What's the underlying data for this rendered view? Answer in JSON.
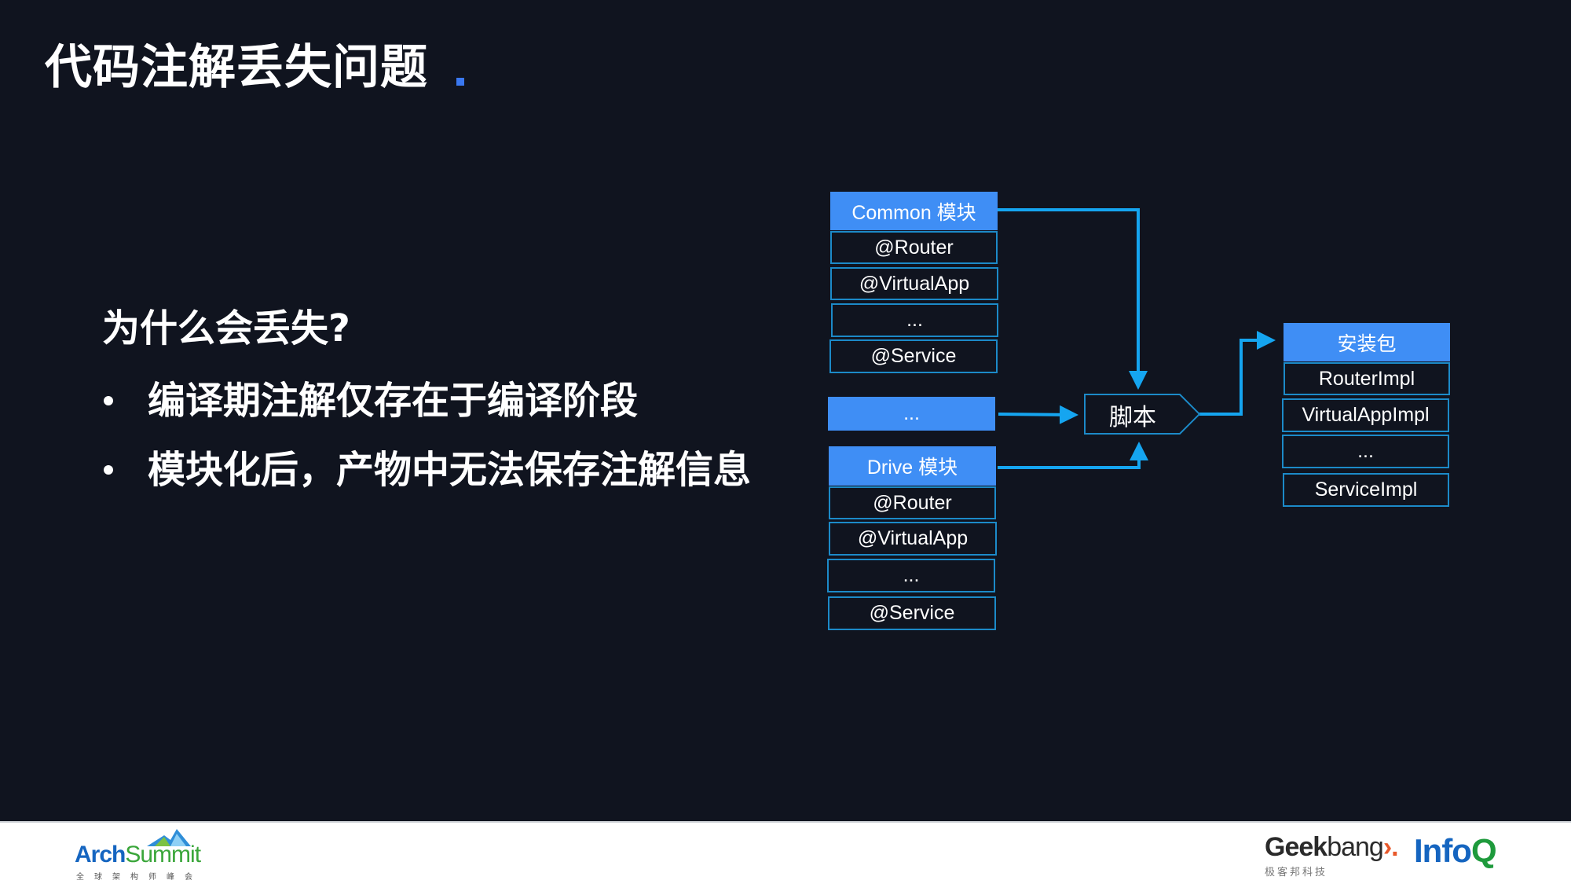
{
  "slide": {
    "title": "代码注解丢失问题",
    "accent_color": "#3a78f0",
    "question": "为什么会丢失?",
    "bullets": [
      "编译期注解仅存在于编译阶段",
      "模块化后，产物中无法保存注解信息"
    ]
  },
  "diagram": {
    "colors": {
      "header": "#3f8ef5",
      "connector": "#15a5f0",
      "row_border": "#1c8ac8",
      "background": "#10141f"
    },
    "common_module": {
      "header": "Common 模块",
      "rows": [
        "@Router",
        "@VirtualApp",
        "...",
        "@Service"
      ]
    },
    "middle_module": {
      "header": "..."
    },
    "drive_module": {
      "header": "Drive 模块",
      "rows": [
        "@Router",
        "@VirtualApp",
        "...",
        "@Service"
      ]
    },
    "script": {
      "label": "脚本"
    },
    "package": {
      "header": "安装包",
      "rows": [
        "RouterImpl",
        "VirtualAppImpl",
        "...",
        "ServiceImpl"
      ]
    }
  },
  "footer": {
    "left_logo": {
      "name_part1": "Arch",
      "name_part2": "Summit",
      "subtitle": "全球架构师峰会"
    },
    "right_logos": {
      "geekbang_part1": "Geek",
      "geekbang_part2": "bang",
      "geekbang_chevron": "›.",
      "geekbang_subtitle": "极客邦科技",
      "infoq_part1": "Info",
      "infoq_part2": "Q"
    }
  }
}
